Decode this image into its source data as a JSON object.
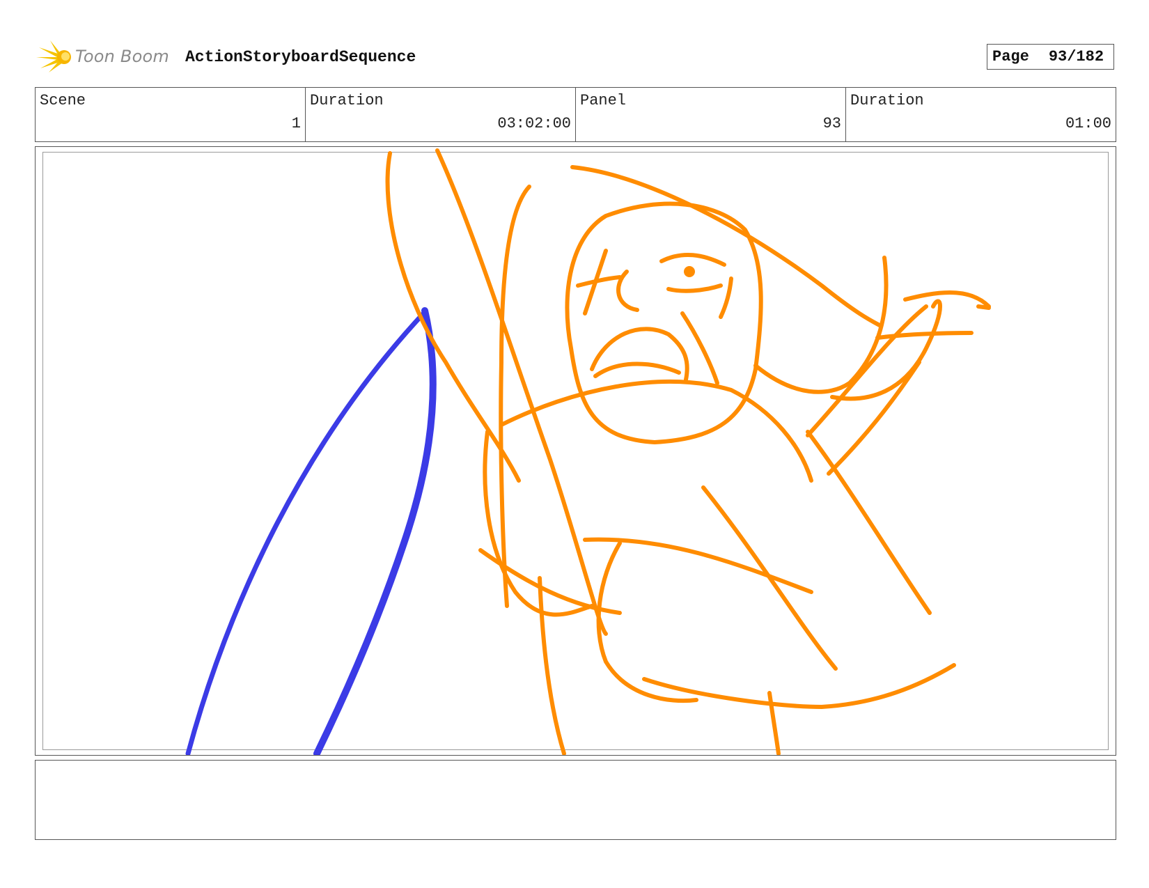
{
  "header": {
    "logo_text": "Toon Boom",
    "sequence_title": "ActionStoryboardSequence",
    "page_label": "Page",
    "page_value": "93/182"
  },
  "info": {
    "scene_label": "Scene",
    "scene_value": "1",
    "scene_duration_label": "Duration",
    "scene_duration_value": "03:02:00",
    "panel_label": "Panel",
    "panel_value": "93",
    "panel_duration_label": "Duration",
    "panel_duration_value": "01:00"
  },
  "colors": {
    "sketch_orange": "#FF8C00",
    "sketch_blue": "#3B3BE6",
    "logo_yellow": "#F5C400"
  },
  "icons": {
    "logo": "starburst-icon"
  }
}
